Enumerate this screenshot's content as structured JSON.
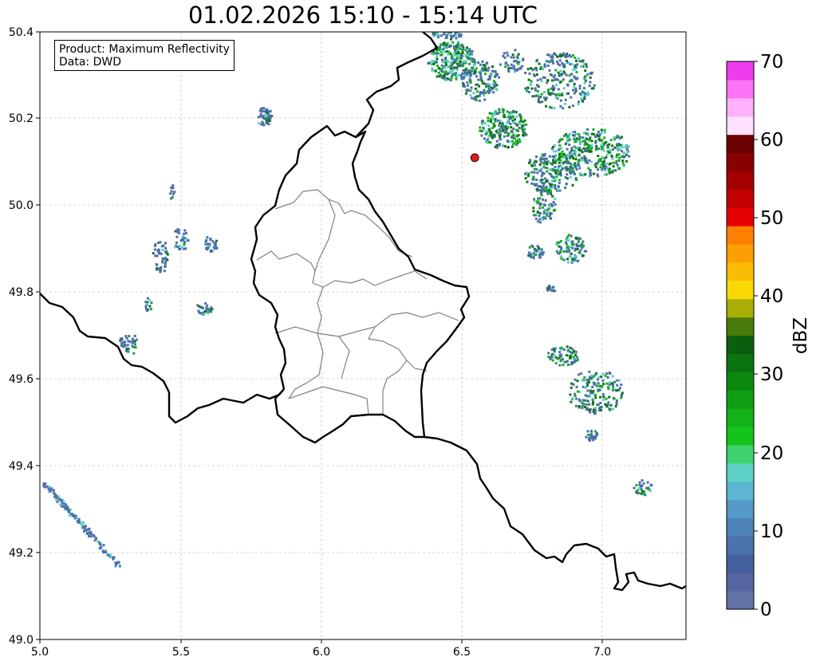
{
  "title": "01.02.2026 15:10 - 15:14 UTC",
  "info": {
    "product_line": "Product: Maximum Reflectivity",
    "data_line": "Data: DWD"
  },
  "map": {
    "lon_range": [
      5.0,
      7.3
    ],
    "lat_range": [
      49.0,
      50.4
    ],
    "x_ticks": [
      "5.0",
      "5.5",
      "6.0",
      "6.5",
      "7.0"
    ],
    "y_ticks": [
      "49.0",
      "49.2",
      "49.4",
      "49.6",
      "49.8",
      "50.0",
      "50.2",
      "50.4"
    ],
    "grid": true,
    "radar_site": {
      "lon": 6.548,
      "lat": 50.11,
      "color": "#e41a1c"
    }
  },
  "colorbar": {
    "label": "dBZ",
    "ticks": [
      "0",
      "10",
      "20",
      "30",
      "40",
      "50",
      "60",
      "70"
    ],
    "range": [
      0,
      70
    ],
    "colors": [
      "#6473a5",
      "#5666a0",
      "#44609e",
      "#4a72ac",
      "#4d82b8",
      "#5599c8",
      "#5cb5d3",
      "#5ed1c6",
      "#3ed36e",
      "#14c41c",
      "#13b219",
      "#0f9d14",
      "#0c8a10",
      "#0b7410",
      "#0a5e0e",
      "#4a7b0a",
      "#a9ae06",
      "#f9d904",
      "#fbbd04",
      "#fd9f03",
      "#ff7f02",
      "#e50004",
      "#c30002",
      "#a40000",
      "#880000",
      "#6a0000",
      "#fce0fe",
      "#ffb0fb",
      "#fb74f6",
      "#ef3bee"
    ]
  },
  "echo_colors": {
    "low": "#4a6fa8",
    "mid": "#5ccfc6",
    "high": "#13b219",
    "peak": "#0b7410"
  }
}
